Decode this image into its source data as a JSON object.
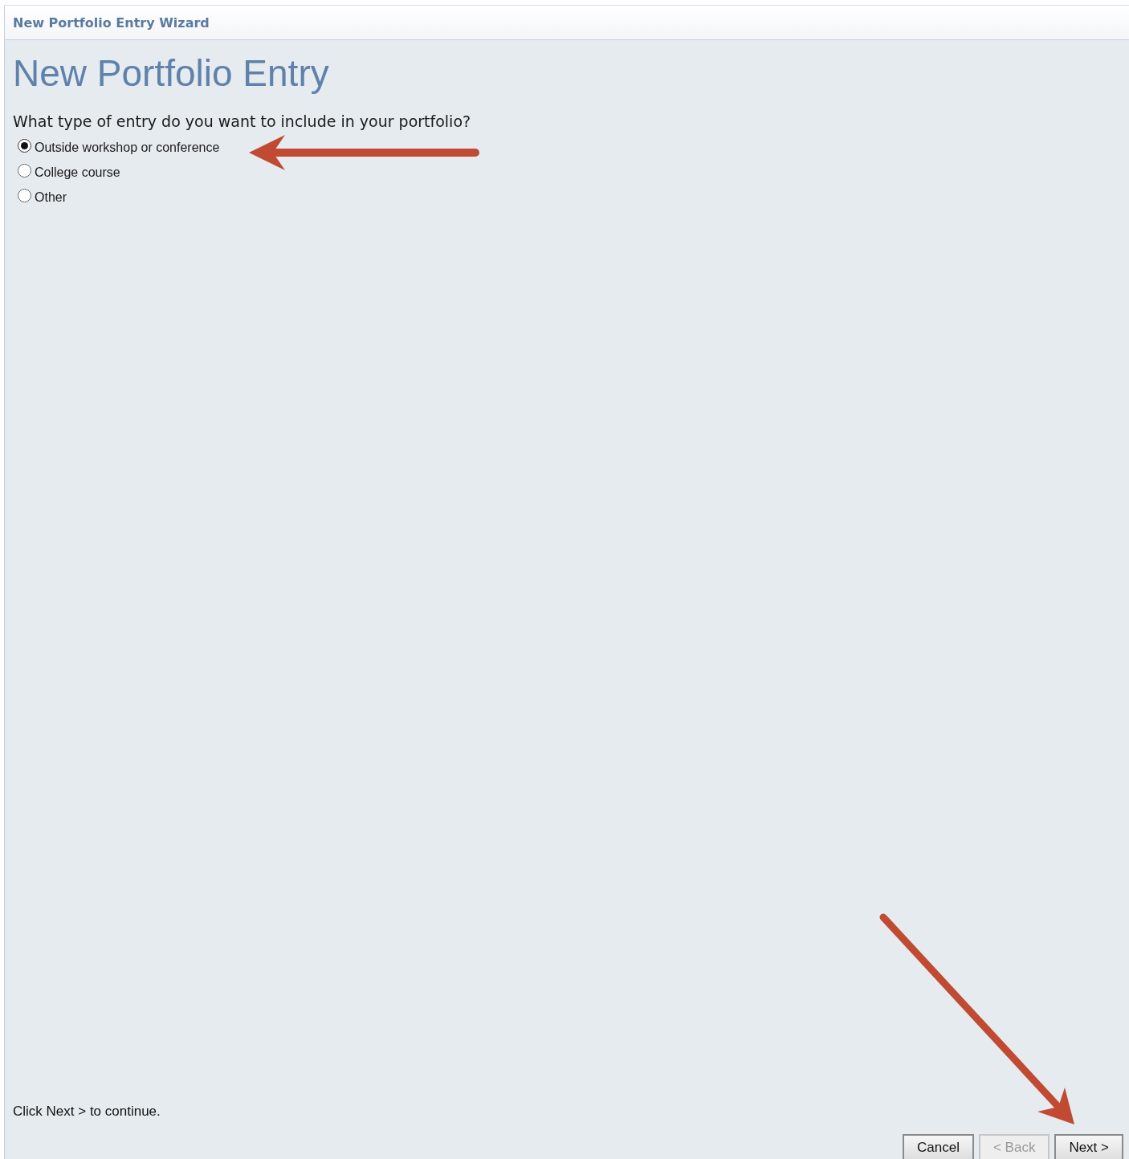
{
  "window": {
    "title": "New Portfolio Entry Wizard"
  },
  "heading": "New Portfolio Entry",
  "question": "What type of entry do you want to include in your portfolio?",
  "options": [
    {
      "label": "Outside workshop or conference",
      "selected": true
    },
    {
      "label": "College course",
      "selected": false
    },
    {
      "label": "Other",
      "selected": false
    }
  ],
  "hint": "Click Next > to continue.",
  "buttons": [
    {
      "label": "Cancel",
      "disabled": false
    },
    {
      "label": "< Back",
      "disabled": true
    },
    {
      "label": "Next >",
      "disabled": false
    }
  ]
}
